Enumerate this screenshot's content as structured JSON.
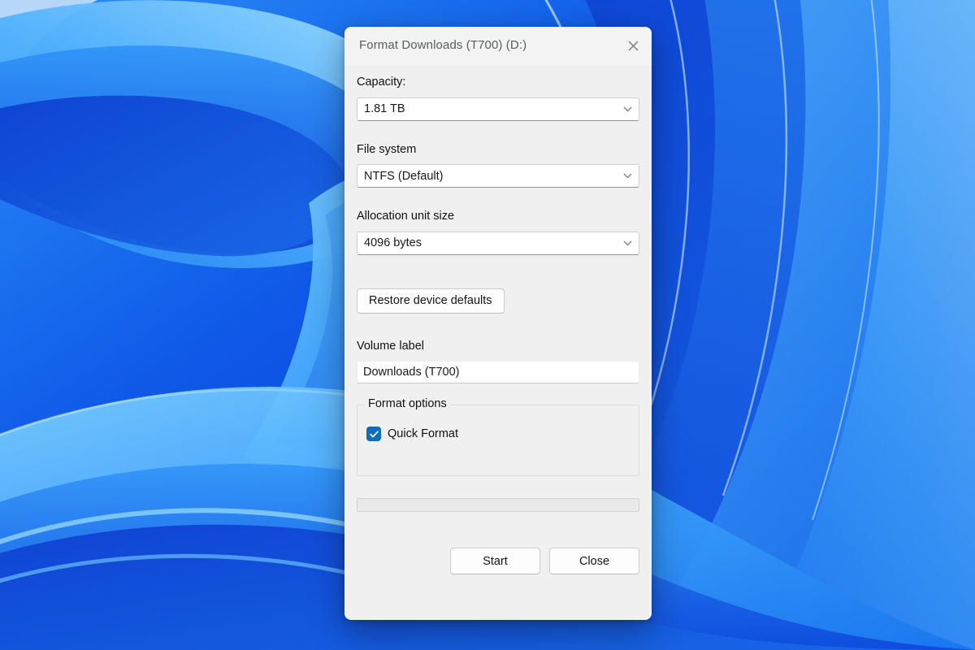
{
  "desktop": {
    "wallpaper_name": "windows-bloom-wallpaper",
    "colors": {
      "deep_blue": "#0a3fd4",
      "mid_blue": "#1677f0",
      "light_blue": "#48a7fb",
      "pale_blue": "#8fd0ff",
      "dark_blue": "#072a9e"
    }
  },
  "dialog": {
    "title": "Format Downloads (T700) (D:)",
    "close_icon": "close-icon",
    "accent_color": "#0f6cbd",
    "capacity": {
      "label": "Capacity:",
      "value": "1.81 TB",
      "chevron_icon": "chevron-down-icon"
    },
    "file_system": {
      "label": "File system",
      "value": "NTFS (Default)",
      "chevron_icon": "chevron-down-icon"
    },
    "allocation_unit": {
      "label": "Allocation unit size",
      "value": "4096 bytes",
      "chevron_icon": "chevron-down-icon"
    },
    "restore_defaults_label": "Restore device defaults",
    "volume_label": {
      "label": "Volume label",
      "value": "Downloads (T700)"
    },
    "format_options": {
      "title": "Format options",
      "quick_format": {
        "label": "Quick Format",
        "checked": true,
        "check_icon": "checkmark-icon"
      }
    },
    "progress": {
      "percent": 0,
      "text": ""
    },
    "buttons": {
      "start": "Start",
      "close": "Close"
    }
  }
}
